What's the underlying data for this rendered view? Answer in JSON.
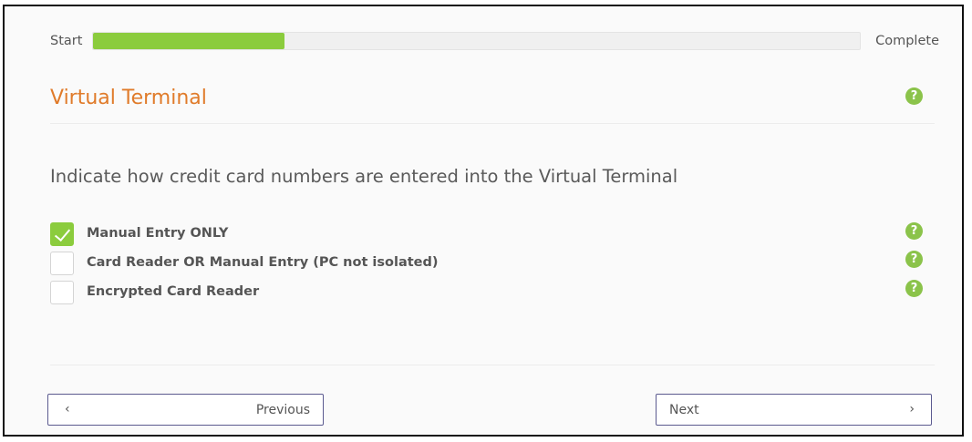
{
  "progress": {
    "start_label": "Start",
    "complete_label": "Complete",
    "value_percent": 25,
    "fill_color": "#8bcc3d"
  },
  "header": {
    "title": "Virtual Terminal",
    "title_color": "#e07b2a",
    "help_glyph": "?"
  },
  "question": {
    "text": "Indicate how credit card numbers are entered into the Virtual Terminal"
  },
  "options": [
    {
      "label": "Manual Entry ONLY",
      "checked": true,
      "help_glyph": "?"
    },
    {
      "label": "Card Reader OR Manual Entry (PC not isolated)",
      "checked": false,
      "help_glyph": "?"
    },
    {
      "label": "Encrypted Card Reader",
      "checked": false,
      "help_glyph": "?"
    }
  ],
  "nav": {
    "previous_label": "Previous",
    "previous_icon": "chevron-left-icon",
    "previous_glyph": "‹",
    "next_label": "Next",
    "next_icon": "chevron-right-icon",
    "next_glyph": "›"
  },
  "colors": {
    "accent_green": "#8bc34a",
    "button_border": "#5b5a8f"
  }
}
